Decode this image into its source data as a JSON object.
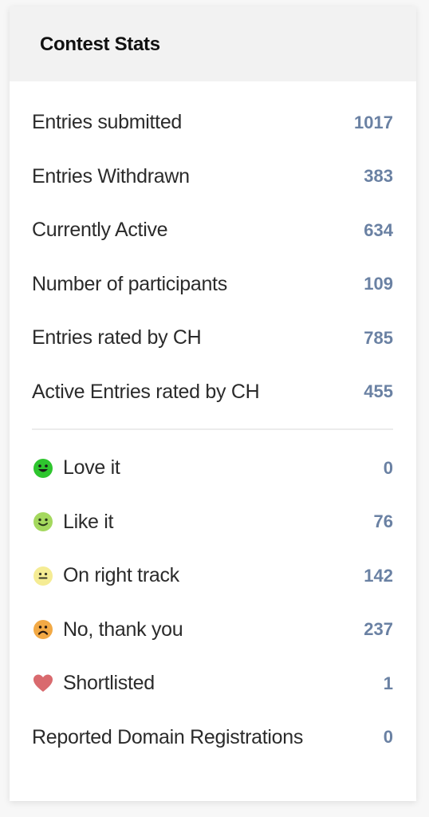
{
  "card": {
    "title": "Contest Stats"
  },
  "stats": [
    {
      "label": "Entries submitted",
      "value": "1017"
    },
    {
      "label": "Entries Withdrawn",
      "value": "383"
    },
    {
      "label": "Currently Active",
      "value": "634"
    },
    {
      "label": "Number of participants",
      "value": "109"
    },
    {
      "label": "Entries rated by CH",
      "value": "785"
    },
    {
      "label": "Active Entries rated by CH",
      "value": "455"
    }
  ],
  "ratings": [
    {
      "icon": "love-it-face-icon",
      "label": "Love it",
      "value": "0",
      "color": "#2ec52e"
    },
    {
      "icon": "like-it-face-icon",
      "label": "Like it",
      "value": "76",
      "color": "#9fd65a"
    },
    {
      "icon": "on-right-track-face-icon",
      "label": "On right track",
      "value": "142",
      "color": "#f3e98f"
    },
    {
      "icon": "no-thank-you-face-icon",
      "label": "No, thank you",
      "value": "237",
      "color": "#f0a843"
    },
    {
      "icon": "heart-icon",
      "label": "Shortlisted",
      "value": "1",
      "color": "#d96a6e"
    },
    {
      "icon": "",
      "label": "Reported Domain Registrations",
      "value": "0",
      "color": ""
    }
  ],
  "colors": {
    "value_text": "#6a81a3",
    "header_bg": "#f2f2f2"
  }
}
